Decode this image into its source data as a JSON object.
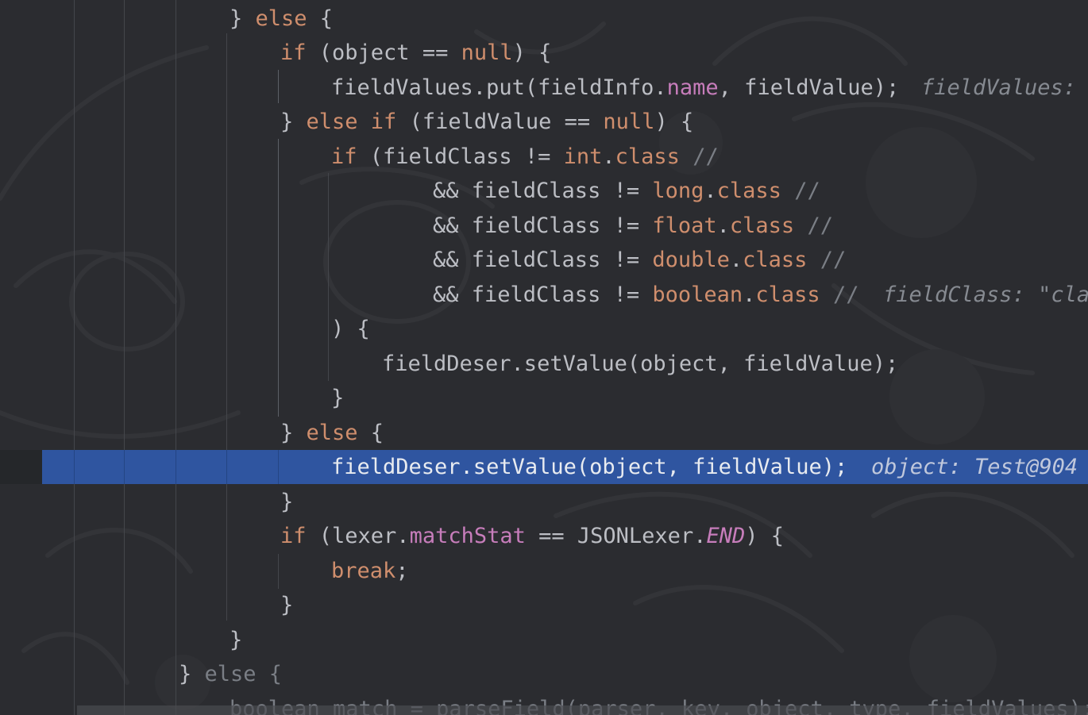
{
  "editor": {
    "language": "java",
    "highlighted_line_index": 13,
    "lines": [
      {
        "segments": [
          [
            "plain",
            "} "
          ],
          [
            "kw",
            "else"
          ],
          [
            "plain",
            " {"
          ]
        ]
      },
      {
        "segments": [
          [
            "kw",
            "if"
          ],
          [
            "plain",
            " (object == "
          ],
          [
            "kw",
            "null"
          ],
          [
            "plain",
            ") {"
          ]
        ]
      },
      {
        "segments": [
          [
            "plain",
            "fieldValues.put(fieldInfo."
          ],
          [
            "field",
            "name"
          ],
          [
            "plain",
            ", fieldValue);"
          ]
        ],
        "hint": "fieldValues: "
      },
      {
        "segments": [
          [
            "plain",
            "} "
          ],
          [
            "kw",
            "else if"
          ],
          [
            "plain",
            " (fieldValue == "
          ],
          [
            "kw",
            "null"
          ],
          [
            "plain",
            ") {"
          ]
        ]
      },
      {
        "segments": [
          [
            "kw",
            "if"
          ],
          [
            "plain",
            " (fieldClass != "
          ],
          [
            "kw",
            "int"
          ],
          [
            "plain",
            "."
          ],
          [
            "kw",
            "class"
          ],
          [
            "plain",
            " "
          ],
          [
            "cmt",
            "//"
          ]
        ]
      },
      {
        "segments": [
          [
            "plain",
            "&& fieldClass != "
          ],
          [
            "kw",
            "long"
          ],
          [
            "plain",
            "."
          ],
          [
            "kw",
            "class"
          ],
          [
            "plain",
            " "
          ],
          [
            "cmt",
            "//"
          ]
        ]
      },
      {
        "segments": [
          [
            "plain",
            "&& fieldClass != "
          ],
          [
            "kw",
            "float"
          ],
          [
            "plain",
            "."
          ],
          [
            "kw",
            "class"
          ],
          [
            "plain",
            " "
          ],
          [
            "cmt",
            "//"
          ]
        ]
      },
      {
        "segments": [
          [
            "plain",
            "&& fieldClass != "
          ],
          [
            "kw",
            "double"
          ],
          [
            "plain",
            "."
          ],
          [
            "kw",
            "class"
          ],
          [
            "plain",
            " "
          ],
          [
            "cmt",
            "//"
          ]
        ]
      },
      {
        "segments": [
          [
            "plain",
            "&& fieldClass != "
          ],
          [
            "kw",
            "boolean"
          ],
          [
            "plain",
            "."
          ],
          [
            "kw",
            "class"
          ],
          [
            "plain",
            " "
          ],
          [
            "cmt",
            "//"
          ]
        ],
        "hint": "fieldClass: \"cla"
      },
      {
        "segments": [
          [
            "plain",
            ") {"
          ]
        ]
      },
      {
        "segments": [
          [
            "plain",
            "fieldDeser.setValue(object, fieldValue);"
          ]
        ]
      },
      {
        "segments": [
          [
            "plain",
            "}"
          ]
        ]
      },
      {
        "segments": [
          [
            "plain",
            "} "
          ],
          [
            "kw",
            "else"
          ],
          [
            "plain",
            " {"
          ]
        ]
      },
      {
        "segments": [
          [
            "sel",
            "fieldDeser.setValue(object, fieldValue);"
          ]
        ],
        "hint": "object: Test@904"
      },
      {
        "segments": [
          [
            "plain",
            "}"
          ]
        ]
      },
      {
        "segments": [
          [
            "kw",
            "if"
          ],
          [
            "plain",
            " (lexer."
          ],
          [
            "field",
            "matchStat"
          ],
          [
            "plain",
            " == JSONLexer."
          ],
          [
            "const",
            "END"
          ],
          [
            "plain",
            ") {"
          ]
        ]
      },
      {
        "segments": [
          [
            "kw",
            "break"
          ],
          [
            "plain",
            ";"
          ]
        ]
      },
      {
        "segments": [
          [
            "plain",
            "}"
          ]
        ]
      },
      {
        "segments": [
          [
            "plain",
            "}"
          ]
        ]
      },
      {
        "segments": [
          [
            "plain",
            "} "
          ],
          [
            "dim",
            "else {"
          ]
        ]
      },
      {
        "segments": [
          [
            "dim",
            "boolean match = parseField(parser, key, object, type, fieldValues);"
          ]
        ]
      }
    ]
  },
  "colors": {
    "background": "#2b2c30",
    "keyword": "#cf8e6d",
    "field": "#c77dbb",
    "comment": "#7a7e85",
    "text": "#bcbec4",
    "selection": "#2f55a0"
  }
}
